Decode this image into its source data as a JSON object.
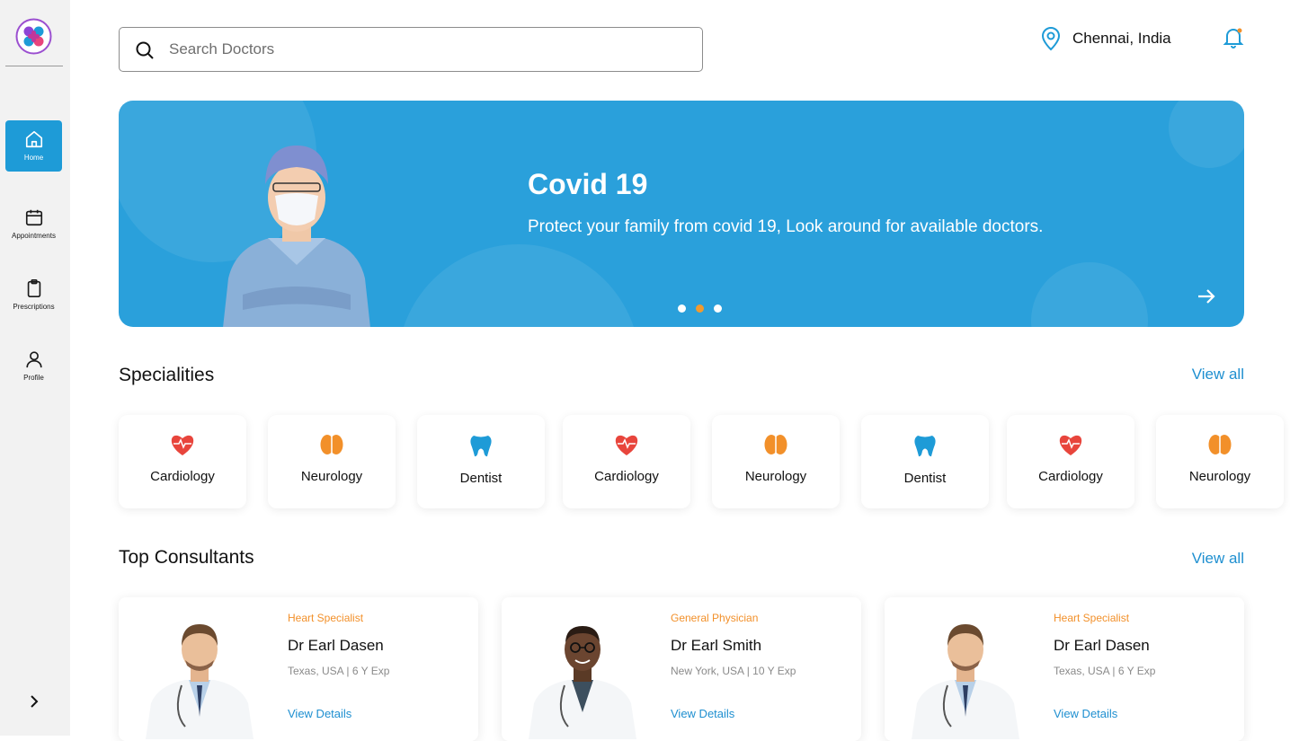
{
  "search": {
    "placeholder": "Search Doctors"
  },
  "header": {
    "location": "Chennai, India"
  },
  "sidebar": {
    "items": [
      {
        "label": "Home"
      },
      {
        "label": "Appointments"
      },
      {
        "label": "Prescriptions"
      },
      {
        "label": "Profile"
      }
    ]
  },
  "banner": {
    "title": "Covid 19",
    "subtitle": "Protect your family from covid 19, Look around for available doctors.",
    "active_slide": 2,
    "slide_count": 3
  },
  "specialities": {
    "title": "Specialities",
    "view_all": "View all",
    "items": [
      {
        "name": "Cardiology",
        "icon": "heart-icon"
      },
      {
        "name": "Neurology",
        "icon": "brain-icon"
      },
      {
        "name": "Dentist",
        "icon": "tooth-icon"
      },
      {
        "name": "Cardiology",
        "icon": "heart-icon"
      },
      {
        "name": "Neurology",
        "icon": "brain-icon"
      },
      {
        "name": "Dentist",
        "icon": "tooth-icon"
      },
      {
        "name": "Cardiology",
        "icon": "heart-icon"
      },
      {
        "name": "Neurology",
        "icon": "brain-icon"
      }
    ]
  },
  "consultants": {
    "title": "Top Consultants",
    "view_all": "View all",
    "items": [
      {
        "specialty": "Heart Specialist",
        "name": "Dr Earl Dasen",
        "meta": "Texas, USA | 6 Y Exp",
        "link": "View Details"
      },
      {
        "specialty": "General Physician",
        "name": "Dr Earl Smith",
        "meta": "New York, USA | 10 Y Exp",
        "link": "View Details"
      },
      {
        "specialty": "Heart Specialist",
        "name": "Dr Earl Dasen",
        "meta": "Texas, USA | 6 Y Exp",
        "link": "View Details"
      }
    ]
  },
  "colors": {
    "primary": "#1e9bd7",
    "banner": "#2aa0db",
    "accent_orange": "#f2902a",
    "heart_red": "#e8453c",
    "brain_orange": "#f2902a",
    "tooth_blue": "#1e9bd7"
  }
}
